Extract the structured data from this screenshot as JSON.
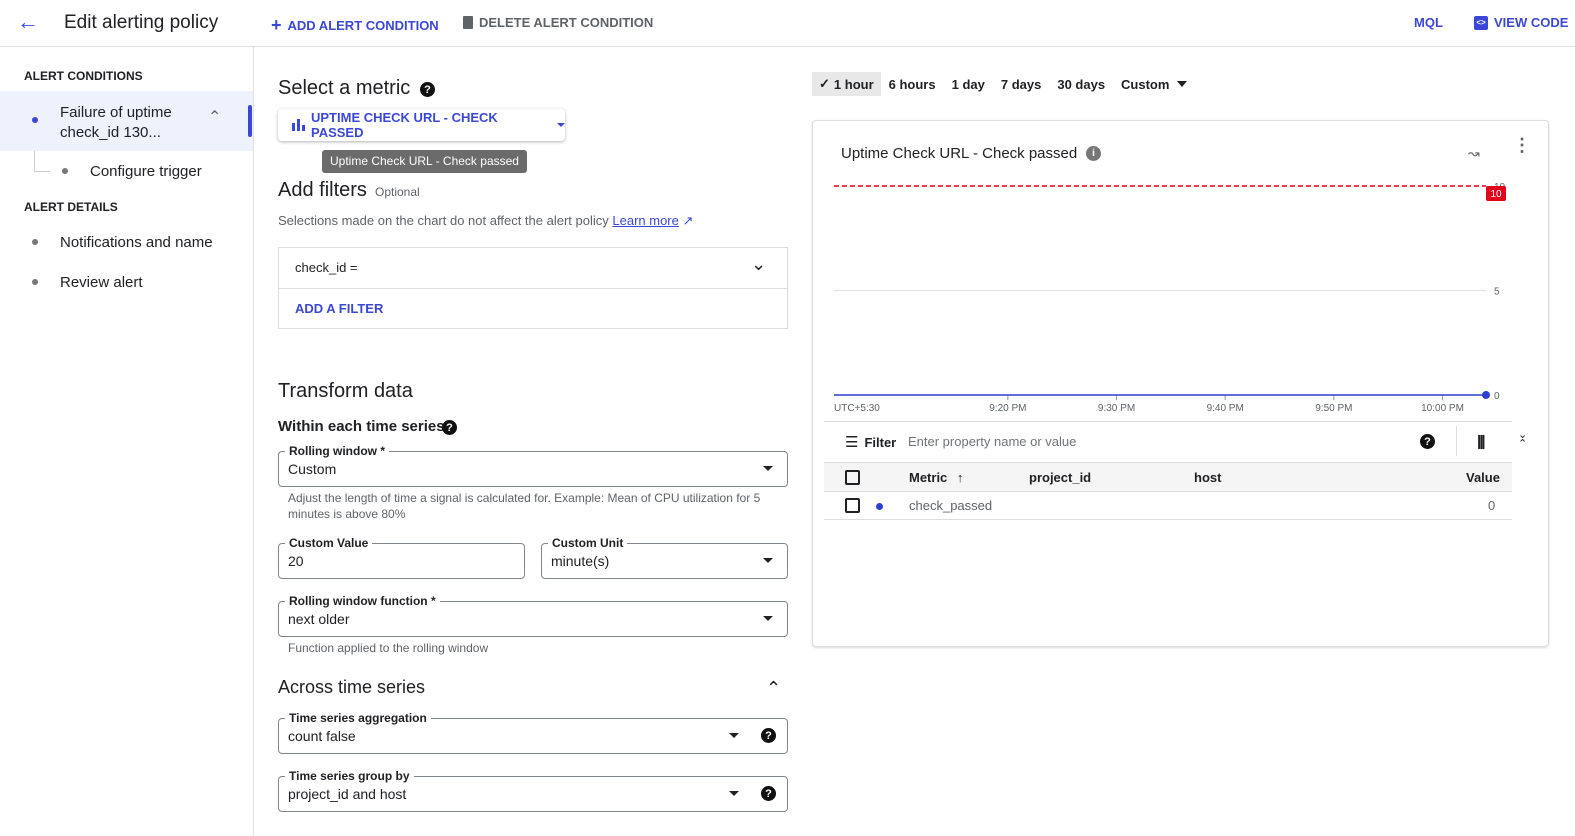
{
  "header": {
    "title": "Edit alerting policy",
    "add_condition": "ADD ALERT CONDITION",
    "delete_condition": "DELETE ALERT CONDITION",
    "mql": "MQL",
    "view_code": "VIEW CODE"
  },
  "sidebar": {
    "conditions_heading": "ALERT CONDITIONS",
    "condition_label_1": "Failure of uptime",
    "condition_label_2": "check_id 130...",
    "configure_trigger": "Configure trigger",
    "details_heading": "ALERT DETAILS",
    "notifications": "Notifications and name",
    "review": "Review alert"
  },
  "metric": {
    "heading": "Select a metric",
    "selector_label": "UPTIME CHECK URL - CHECK PASSED",
    "tooltip": "Uptime Check URL - Check passed"
  },
  "filters": {
    "heading": "Add filters",
    "optional": "Optional",
    "hint": "Selections made on the chart do not affect the alert policy",
    "learn_more": "Learn more",
    "filter_value": "check_id =",
    "add_filter": "ADD A FILTER"
  },
  "transform": {
    "heading": "Transform data",
    "within_heading": "Within each time series",
    "rolling_window_label": "Rolling window *",
    "rolling_window_value": "Custom",
    "rolling_window_hint": "Adjust the length of time a signal is calculated for. Example: Mean of CPU utilization for 5 minutes is above 80%",
    "custom_value_label": "Custom Value",
    "custom_value": "20",
    "custom_unit_label": "Custom Unit",
    "custom_unit": "minute(s)",
    "function_label": "Rolling window function *",
    "function_value": "next older",
    "function_hint": "Function applied to the rolling window",
    "across_heading": "Across time series",
    "aggregation_label": "Time series aggregation",
    "aggregation_value": "count false",
    "group_by_label": "Time series group by",
    "group_by_value": "project_id and host"
  },
  "time_range": {
    "options": [
      "1 hour",
      "6 hours",
      "1 day",
      "7 days",
      "30 days",
      "Custom"
    ],
    "selected": "1 hour"
  },
  "chart_panel": {
    "title": "Uptime Check URL - Check passed",
    "filter_label": "Filter",
    "filter_placeholder": "Enter property name or value",
    "columns": [
      "Metric",
      "project_id",
      "host",
      "Value"
    ],
    "rows": [
      {
        "metric": "check_passed",
        "project_id": "",
        "host": "",
        "value": "0"
      }
    ]
  },
  "colors": {
    "accent": "#3b47d6",
    "threshold": "#e3001b",
    "series": "#2c3fd1"
  },
  "chart_data": {
    "type": "line",
    "title": "Uptime Check URL - Check passed",
    "timezone_label": "UTC+5:30",
    "x_range_minutes": [
      1264,
      1324
    ],
    "x_ticks": [
      {
        "label": "9:20 PM",
        "min": 1280
      },
      {
        "label": "9:30 PM",
        "min": 1290
      },
      {
        "label": "9:40 PM",
        "min": 1300
      },
      {
        "label": "9:50 PM",
        "min": 1310
      },
      {
        "label": "10:00 PM",
        "min": 1320
      }
    ],
    "ylim": [
      0,
      10
    ],
    "y_ticks": [
      "0",
      "5",
      "10"
    ],
    "series": [
      {
        "name": "check_passed",
        "x": [
          1264,
          1324
        ],
        "values": [
          0,
          0
        ]
      }
    ],
    "threshold": {
      "value": 10,
      "label": "10"
    }
  }
}
